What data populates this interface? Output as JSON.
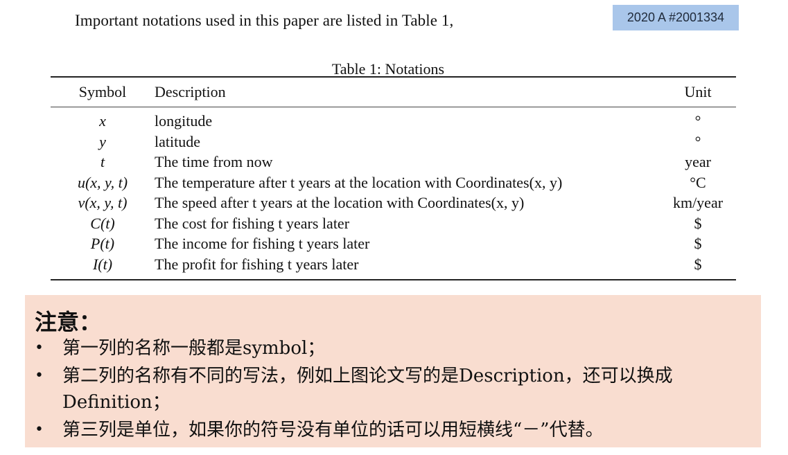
{
  "intro_text": "Important notations used in this paper are listed in Table 1,",
  "badge": "2020 A #2001334",
  "table": {
    "caption": "Table 1: Notations",
    "headers": [
      "Symbol",
      "Description",
      "Unit"
    ],
    "rows": [
      {
        "symbol": "x",
        "description": "longitude",
        "unit": "°"
      },
      {
        "symbol": "y",
        "description": "latitude",
        "unit": "°"
      },
      {
        "symbol": "t",
        "description": "The time from now",
        "unit": "year"
      },
      {
        "symbol": "u(x, y, t)",
        "description": "The temperature after t years at the location with Coordinates(x, y)",
        "unit": "°C"
      },
      {
        "symbol": "v(x, y, t)",
        "description": "The speed after t years at the location with Coordinates(x, y)",
        "unit": "km/year"
      },
      {
        "symbol": "C(t)",
        "description": "The cost for fishing t years later",
        "unit": "$"
      },
      {
        "symbol": "P(t)",
        "description": "The income for fishing t years later",
        "unit": "$"
      },
      {
        "symbol": "I(t)",
        "description": "The profit for fishing t years later",
        "unit": "$"
      }
    ]
  },
  "note": {
    "title": "注意：",
    "bullet_glyph": "•",
    "items": [
      "第一列的名称一般都是symbol；",
      "第二列的名称有不同的写法，例如上图论文写的是Description，还可以换成Definition；",
      "第三列是单位，如果你的符号没有单位的话可以用短横线“－”代替。"
    ]
  }
}
